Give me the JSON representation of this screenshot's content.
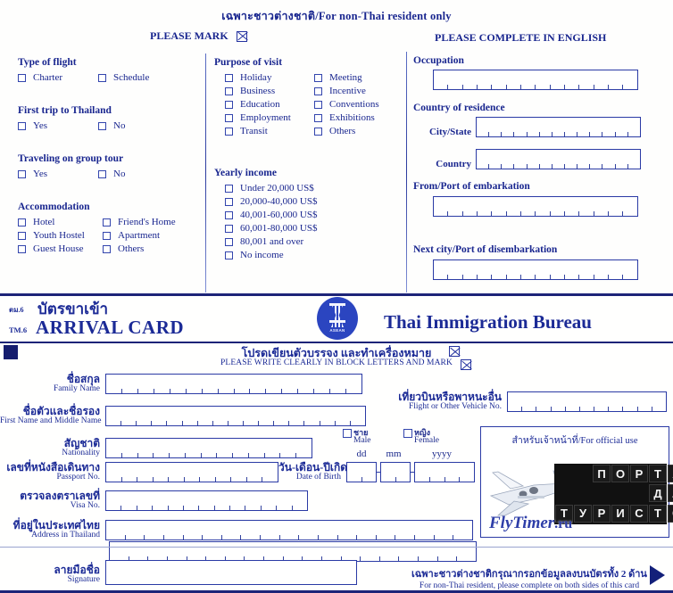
{
  "back_side": {
    "title": "เฉพาะชาวต่างชาติ/For non-Thai resident only",
    "please_mark": "PLEASE MARK",
    "please_complete": "PLEASE COMPLETE IN ENGLISH",
    "groups": {
      "type_of_flight": {
        "title": "Type of flight",
        "options": [
          "Charter",
          "Schedule"
        ]
      },
      "first_trip": {
        "title": "First trip to Thailand",
        "options": [
          "Yes",
          "No"
        ]
      },
      "group_tour": {
        "title": "Traveling on group tour",
        "options": [
          "Yes",
          "No"
        ]
      },
      "accommodation": {
        "title": "Accommodation",
        "col1": [
          "Hotel",
          "Youth Hostel",
          "Guest House"
        ],
        "col2": [
          "Friend's Home",
          "Apartment",
          "Others"
        ]
      },
      "purpose_of_visit": {
        "title": "Purpose of visit",
        "col1": [
          "Holiday",
          "Business",
          "Education",
          "Employment",
          "Transit"
        ],
        "col2": [
          "Meeting",
          "Incentive",
          "Conventions",
          "Exhibitions",
          "Others"
        ]
      },
      "yearly_income": {
        "title": "Yearly income",
        "options": [
          "Under 20,000 US$",
          "20,000-40,000 US$",
          "40,001-60,000 US$",
          "60,001-80,000 US$",
          "80,001 and over",
          "No income"
        ]
      }
    },
    "fields": [
      {
        "label": "Occupation",
        "value": ""
      },
      {
        "label": "Country of residence",
        "value": ""
      },
      {
        "label": "City/State",
        "value": ""
      },
      {
        "label": "Country",
        "value": ""
      },
      {
        "label": "From/Port of embarkation",
        "value": ""
      },
      {
        "label": "Next city/Port of disembarkation",
        "value": ""
      }
    ]
  },
  "card_header": {
    "code_thai": "ตม.6",
    "code_en": "TM.6",
    "title_thai": "บัตรขาเข้า",
    "title_en": "ARRIVAL CARD",
    "bureau": "Thai Immigration Bureau",
    "logo_word": "ASEAN"
  },
  "card_body": {
    "instruction_thai": "โปรดเขียนตัวบรรจง และทำเครื่องหมาย",
    "instruction_en": "PLEASE WRITE CLEARLY IN BLOCK LETTERS AND MARK",
    "rows": [
      {
        "th": "ชื่อสกุล",
        "en": "Family Name",
        "value": ""
      },
      {
        "th": "ชื่อตัวและชื่อรอง",
        "en": "First Name and Middle Name",
        "value": ""
      },
      {
        "th": "สัญชาติ",
        "en": "Nationality",
        "value": ""
      },
      {
        "th": "เลขที่หนังสือเดินทาง",
        "en": "Passport No.",
        "value": ""
      },
      {
        "th": "ตรวจลงตราเลขที่",
        "en": "Visa No.",
        "value": ""
      },
      {
        "th": "ที่อยู่ในประเทศไทย",
        "en": "Address in Thailand",
        "value": ""
      },
      {
        "th": "ลายมือชื่อ",
        "en": "Signature",
        "value": ""
      }
    ],
    "flight": {
      "th": "เที่ยวบินหรือพาหนะอื่น",
      "en": "Flight or Other Vehicle No.",
      "value": ""
    },
    "gender": {
      "male": {
        "th": "ชาย",
        "en": "Male"
      },
      "female": {
        "th": "หญิง",
        "en": "Female"
      }
    },
    "dob": {
      "th": "วัน-เดือน-ปีเกิด",
      "en": "Date of Birth",
      "dd": "dd",
      "mm": "mm",
      "yyyy": "yyyy",
      "dd_value": "",
      "mm_value": "",
      "yyyy_value": ""
    },
    "official_use": "สำหรับเจ้าหน้าที่/For official use",
    "footer_thai": "เฉพาะชาวต่างชาติกรุณากรอกข้อมูลลงบนบัตรทั้ง 2 ด้าน",
    "footer_en": "For non-Thai resident, please complete on both sides of this card"
  },
  "watermark": {
    "line1": "ПОРТАЛ",
    "line2": "ДЛЯ",
    "line3": "ТУРИСТОВ",
    "brand": "FlyTimer",
    "brand_tld": ".ru"
  },
  "colors": {
    "ink": "#1b2a96",
    "rule": "#1d2478",
    "box_border": "#2a3aa5"
  }
}
